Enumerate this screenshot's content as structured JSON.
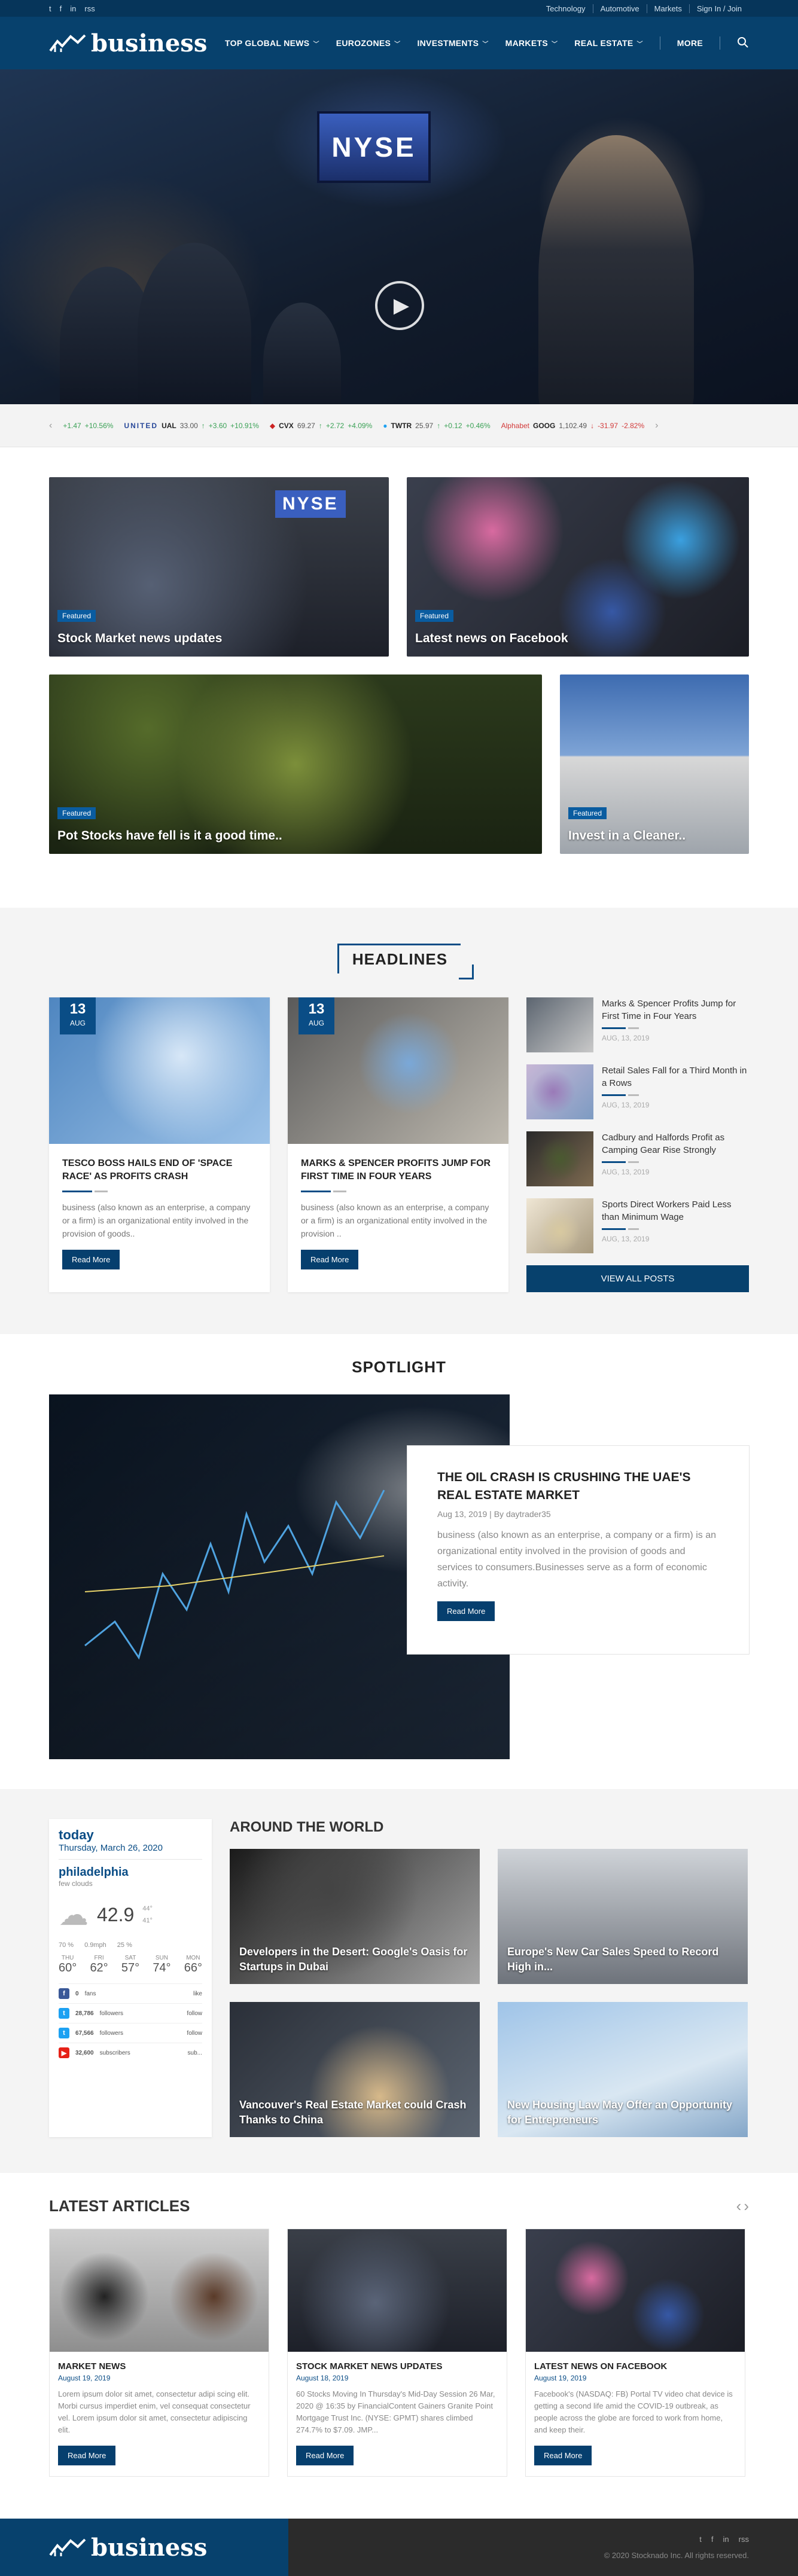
{
  "topbar": {
    "social": [
      "t",
      "f",
      "in",
      "rss"
    ],
    "links": [
      "Technology",
      "Automotive",
      "Markets",
      "Sign In / Join"
    ]
  },
  "brand": {
    "name": "business"
  },
  "nav": {
    "items": [
      "TOP GLOBAL NEWS",
      "EUROZONES",
      "INVESTMENTS",
      "MARKETS",
      "REAL ESTATE"
    ],
    "more": "MORE"
  },
  "hero": {
    "board_text": "NYSE"
  },
  "ticker": [
    {
      "brand": "",
      "sym": "",
      "price": "",
      "chg": "+1.47",
      "pct": "+10.56%",
      "dir": "up"
    },
    {
      "brand": "UNITED",
      "sym": "UAL",
      "price": "33.00",
      "chg": "+3.60",
      "pct": "+10.91%",
      "dir": "up"
    },
    {
      "brand": "",
      "sym": "CVX",
      "price": "69.27",
      "chg": "+2.72",
      "pct": "+4.09%",
      "dir": "up"
    },
    {
      "brand": "",
      "sym": "TWTR",
      "price": "25.97",
      "chg": "+0.12",
      "pct": "+0.46%",
      "dir": "up"
    },
    {
      "brand": "Alphabet",
      "sym": "GOOG",
      "price": "1,102.49",
      "chg": "-31.97",
      "pct": "-2.82%",
      "dir": "down"
    }
  ],
  "featured": {
    "tag": "Featured",
    "cards": [
      "Stock Market news updates",
      "Latest news on Facebook",
      "Pot Stocks have fell is it a good time..",
      "Invest in a Cleaner.."
    ]
  },
  "headlines": {
    "title": "HEADLINES",
    "cards": [
      {
        "day": "13",
        "month": "AUG",
        "title": "TESCO BOSS HAILS END OF 'SPACE RACE' AS PROFITS CRASH",
        "text": "business (also known as an enterprise, a company or a firm) is an organizational entity involved in the provision of goods..",
        "button": "Read More"
      },
      {
        "day": "13",
        "month": "AUG",
        "title": "MARKS & SPENCER PROFITS JUMP FOR FIRST TIME IN FOUR YEARS",
        "text": "business (also known as an enterprise, a company or a firm) is an organizational entity involved in the provision ..",
        "button": "Read More"
      }
    ],
    "side": [
      {
        "title": "Marks & Spencer Profits Jump for First Time in Four Years",
        "date": "AUG, 13, 2019"
      },
      {
        "title": "Retail Sales Fall for a Third Month in a Rows",
        "date": "AUG, 13, 2019"
      },
      {
        "title": "Cadbury and Halfords Profit as Camping Gear Rise Strongly",
        "date": "AUG, 13, 2019"
      },
      {
        "title": "Sports Direct Workers Paid Less than Minimum Wage",
        "date": "AUG, 13, 2019"
      }
    ],
    "view_all": "VIEW ALL POSTS"
  },
  "spotlight": {
    "title": "SPOTLIGHT",
    "headline": "THE OIL CRASH IS CRUSHING THE UAE'S REAL ESTATE MARKET",
    "date": "Aug 13, 2019",
    "author": "By daytrader35",
    "text": "business (also known as an enterprise, a company or a firm) is an organizational entity involved in the provision of goods and services to consumers.Businesses serve as a form of economic activity.",
    "button": "Read More"
  },
  "weather": {
    "today": "today",
    "date": "Thursday, March 26, 2020",
    "city": "philadelphia",
    "condition": "few clouds",
    "temp": "42.9",
    "unit": "°F",
    "high": "44°",
    "low": "41°",
    "stats": [
      "70 %",
      "0.9mph",
      "25 %"
    ],
    "days": [
      {
        "d": "THU",
        "t": "60°"
      },
      {
        "d": "FRI",
        "t": "62°"
      },
      {
        "d": "SAT",
        "t": "57°"
      },
      {
        "d": "SUN",
        "t": "74°"
      },
      {
        "d": "MON",
        "t": "66°"
      }
    ],
    "social": [
      {
        "icon": "f",
        "color": "#3b5998",
        "count": "0",
        "label": "fans",
        "action": "like"
      },
      {
        "icon": "t",
        "color": "#1da1f2",
        "count": "28,786",
        "label": "followers",
        "action": "follow"
      },
      {
        "icon": "t",
        "color": "#1da1f2",
        "count": "67,566",
        "label": "followers",
        "action": "follow"
      },
      {
        "icon": "▶",
        "color": "#e62117",
        "count": "32,600",
        "label": "subscribers",
        "action": "sub..."
      }
    ]
  },
  "around": {
    "title": "AROUND THE WORLD",
    "items": [
      "Developers in the Desert: Google's Oasis for Startups in Dubai",
      "Europe's New Car Sales Speed to Record High in...",
      "Vancouver's Real Estate Market could Crash Thanks to China",
      "New Housing Law May Offer an Opportunity for Entrepreneurs"
    ]
  },
  "latest": {
    "title": "LATEST ARTICLES",
    "items": [
      {
        "title": "MARKET NEWS",
        "date": "August 19, 2019",
        "text": "Lorem ipsum dolor sit amet, consectetur adipi scing elit. Morbi cursus imperdiet enim, vel consequat consectetur vel. Lorem ipsum dolor sit amet, consectetur adipiscing elit.",
        "button": "Read More"
      },
      {
        "title": "STOCK MARKET NEWS UPDATES",
        "date": "August 18, 2019",
        "text": "60 Stocks Moving In Thursday's Mid-Day Session 26 Mar, 2020 @ 16:35 by FinancialContent Gainers Granite Point Mortgage Trust Inc. (NYSE: GPMT) shares climbed 274.7% to $7.09. JMP...",
        "button": "Read More"
      },
      {
        "title": "LATEST NEWS ON FACEBOOK",
        "date": "August 19, 2019",
        "text": "Facebook's (NASDAQ: FB) Portal TV video chat device is getting a second life amid the COVID-19 outbreak, as people across the globe are forced to work from home, and keep their.",
        "button": "Read More"
      }
    ]
  },
  "footer": {
    "copyright": "© 2020 Stocknado Inc. All rights reserved.",
    "social": [
      "t",
      "f",
      "in",
      "rss"
    ]
  }
}
